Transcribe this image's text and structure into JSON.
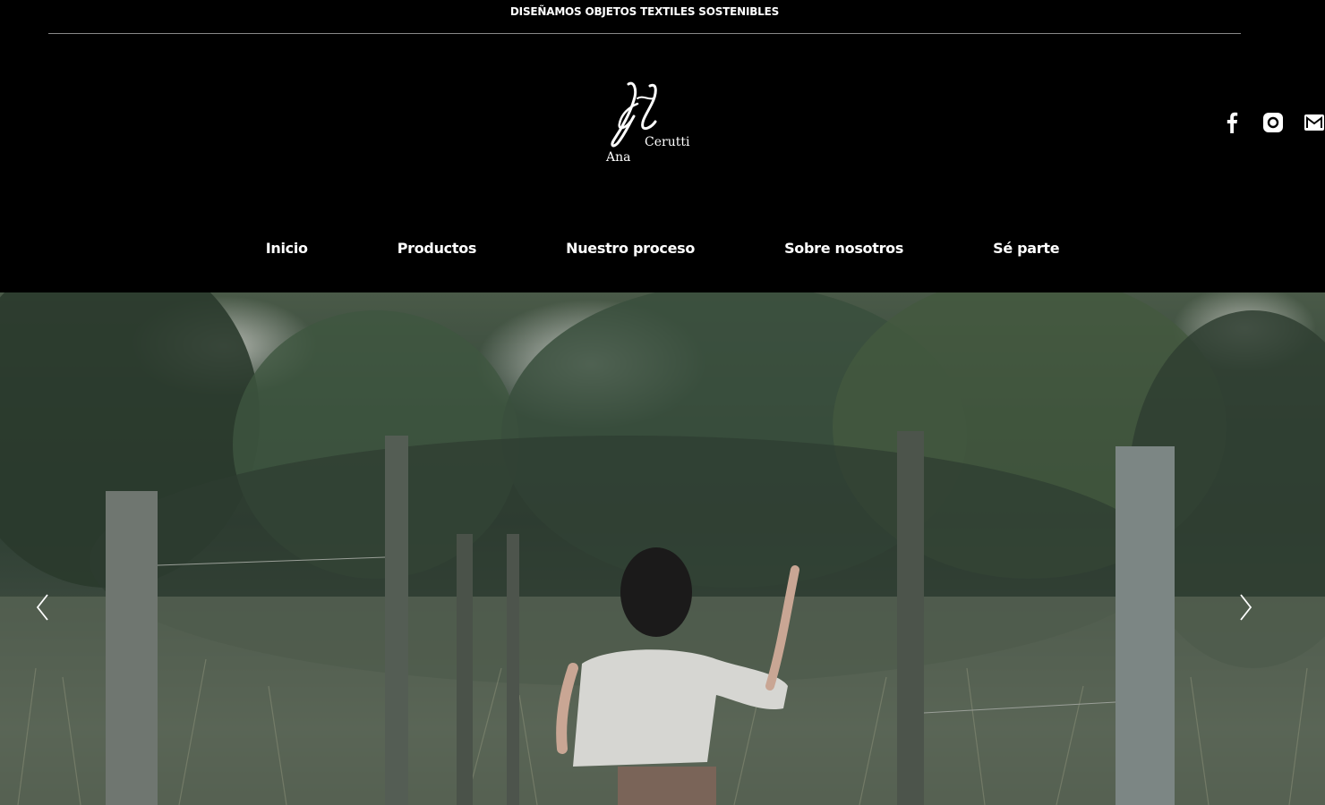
{
  "tagline": "DISEÑAMOS OBJETOS TEXTILES SOSTENIBLES",
  "logo": {
    "first_name": "Ana",
    "last_name": "Cerutti"
  },
  "social": [
    {
      "icon": "facebook-icon"
    },
    {
      "icon": "instagram-icon"
    },
    {
      "icon": "mail-icon"
    }
  ],
  "nav": {
    "items": [
      {
        "label": "Inicio"
      },
      {
        "label": "Productos"
      },
      {
        "label": "Nuestro proceso"
      },
      {
        "label": "Sobre nosotros"
      },
      {
        "label": "Sé parte"
      }
    ]
  },
  "hero": {
    "prev_icon": "chevron-left-icon",
    "next_icon": "chevron-right-icon"
  },
  "colors": {
    "background": "#000000",
    "text": "#ffffff"
  }
}
